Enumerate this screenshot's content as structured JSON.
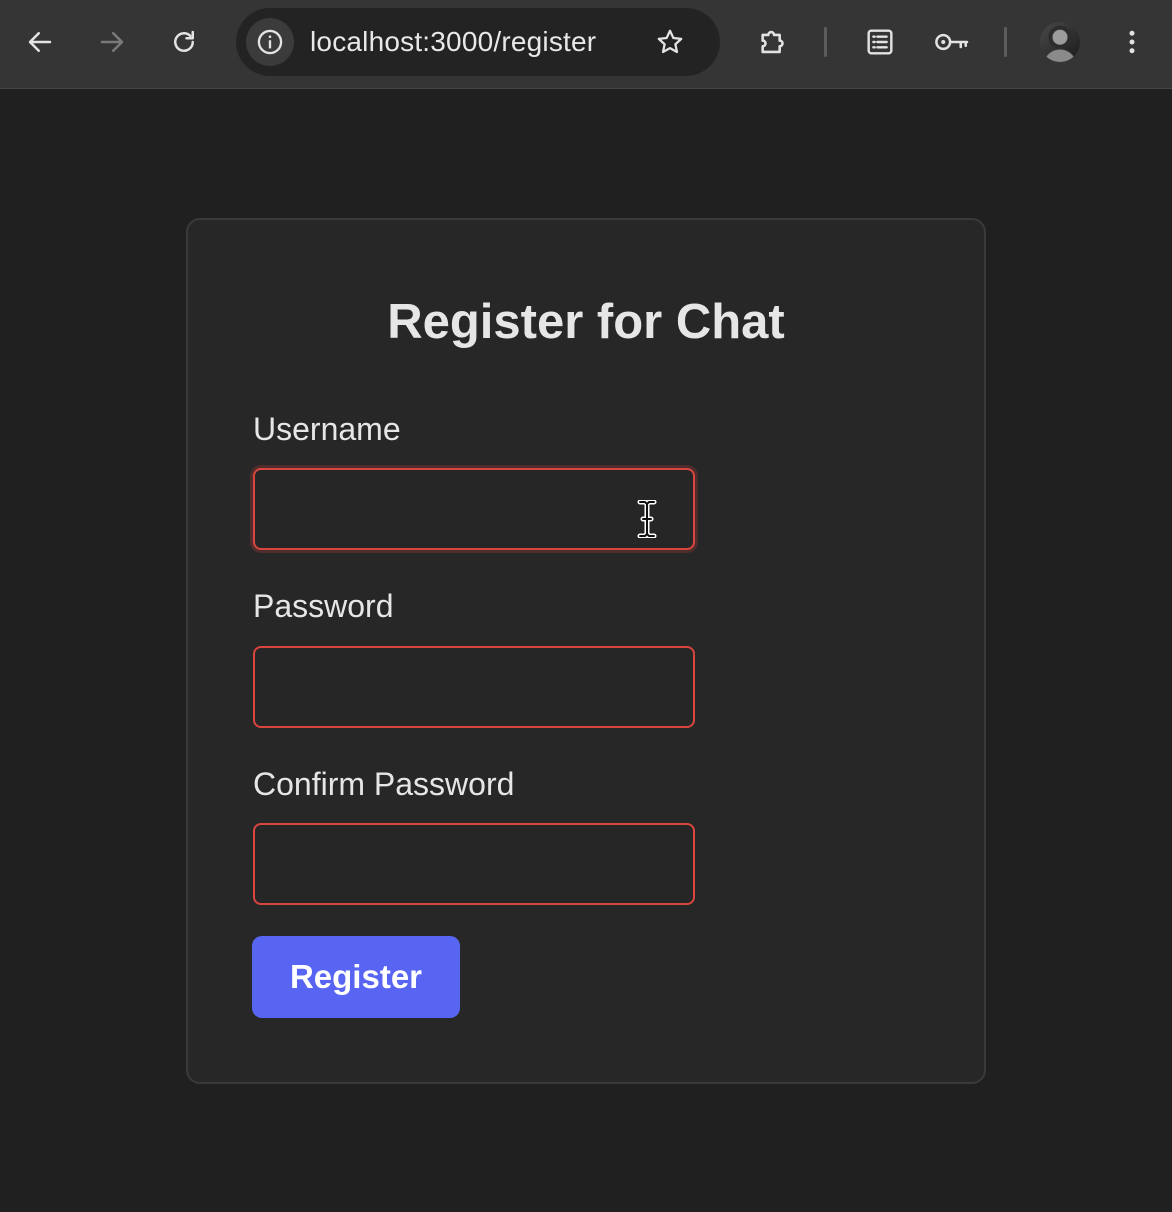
{
  "browser": {
    "url": "localhost:3000/register",
    "icons": {
      "back": "arrow-left-icon",
      "forward": "arrow-right-icon",
      "reload": "reload-icon",
      "site_info": "info-icon",
      "bookmark": "star-icon",
      "extensions": "puzzle-piece-icon",
      "reading_list": "reading-list-icon",
      "passwords": "key-icon",
      "profile": "avatar",
      "menu": "kebab-menu-icon"
    }
  },
  "form": {
    "title": "Register for Chat",
    "username": {
      "label": "Username",
      "value": "",
      "placeholder": ""
    },
    "password": {
      "label": "Password",
      "value": "",
      "placeholder": ""
    },
    "confirm_password": {
      "label": "Confirm Password",
      "value": "",
      "placeholder": ""
    },
    "submit_label": "Register"
  },
  "colors": {
    "page_background": "#202020",
    "card_background": "#272727",
    "input_error_border": "#d9453f",
    "button_accent": "#5865f2"
  }
}
